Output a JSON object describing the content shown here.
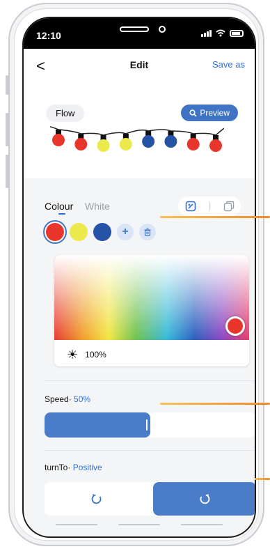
{
  "status": {
    "time": "12:10"
  },
  "header": {
    "title": "Edit",
    "save_as": "Save as",
    "back": "<"
  },
  "scene": {
    "mode_label": "Flow",
    "preview_label": "Preview",
    "bulb_colors": [
      "#e8362d",
      "#e8362d",
      "#ece94c",
      "#ece94c",
      "#2553a6",
      "#2553a6",
      "#e8362d",
      "#e8362d"
    ]
  },
  "colour_tabs": {
    "colour": "Colour",
    "white": "White"
  },
  "swatches": [
    "#e8362d",
    "#ece94c",
    "#2553a6"
  ],
  "picker": {
    "brightness_value": "100%",
    "selected_color": "#e8362d"
  },
  "speed": {
    "label": "Speed·",
    "value_text": " 50%",
    "value": 0.5
  },
  "turn": {
    "label": "turnTo·",
    "value_text": " Positive"
  },
  "colors": {
    "accent": "#2f6fd6",
    "fill": "#4a7cc8"
  }
}
